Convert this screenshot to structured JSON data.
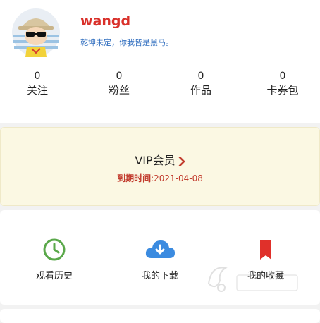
{
  "profile": {
    "username": "wangd",
    "motto": "乾坤未定，你我皆是黑马。"
  },
  "stats": [
    {
      "value": "0",
      "label": "关注"
    },
    {
      "value": "0",
      "label": "粉丝"
    },
    {
      "value": "0",
      "label": "作品"
    },
    {
      "value": "0",
      "label": "卡券包"
    }
  ],
  "vip": {
    "title": "VIP会员",
    "expire_label": "到期时间",
    "expire_sep": ":",
    "expire_date": "2021-04-08"
  },
  "shortcuts": [
    {
      "label": "观看历史",
      "icon": "clock-icon",
      "color": "#5aa84a"
    },
    {
      "label": "我的下载",
      "icon": "cloud-download-icon",
      "color": "#3b8be0"
    },
    {
      "label": "我的收藏",
      "icon": "bookmark-icon",
      "color": "#e0302a"
    }
  ],
  "colors": {
    "username": "#d9302a",
    "motto": "#2f6dbf",
    "vip_bg": "#fbf8e3",
    "vip_expire": "#c23c2e"
  }
}
